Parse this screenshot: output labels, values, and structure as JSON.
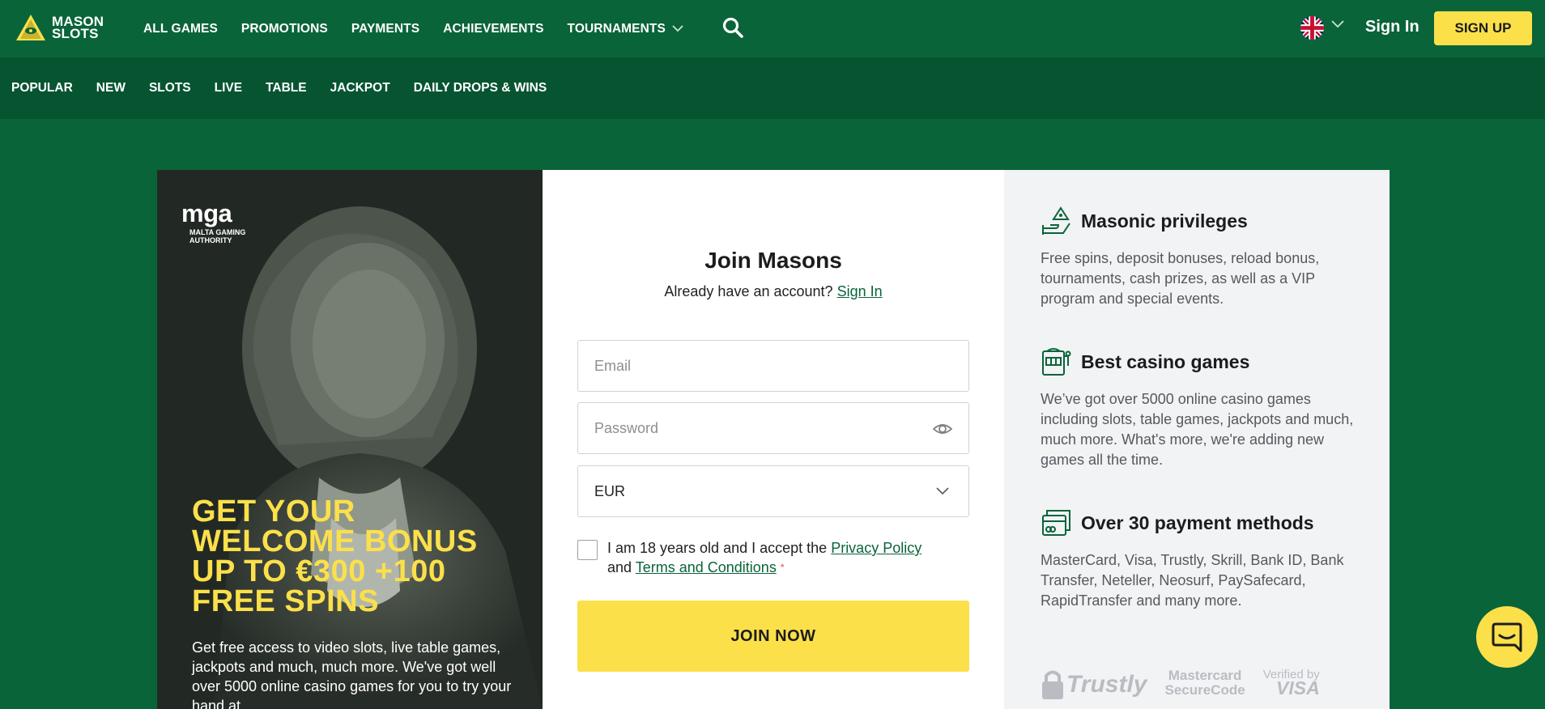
{
  "brand": {
    "line1": "MASON",
    "line2": "SLOTS"
  },
  "nav": {
    "items": [
      "ALL GAMES",
      "PROMOTIONS",
      "PAYMENTS",
      "ACHIEVEMENTS",
      "TOURNAMENTS"
    ],
    "signin": "Sign In",
    "signup": "SIGN UP"
  },
  "subnav": {
    "items": [
      "POPULAR",
      "NEW",
      "SLOTS",
      "LIVE",
      "TABLE",
      "JACKPOT",
      "DAILY DROPS & WINS"
    ]
  },
  "promo": {
    "mga_logo": "mga",
    "mga_caption_1": "MALTA GAMING",
    "mga_caption_2": "AUTHORITY",
    "headline_1": "GET YOUR",
    "headline_2": "WELCOME BONUS",
    "headline_3": "UP TO €300 +100",
    "headline_4": "FREE SPINS",
    "text": "Get free access to video slots, live table games, jackpots and much, much more. We've got well over 5000 online casino games for you to try your hand at."
  },
  "form": {
    "title": "Join Masons",
    "subtitle": "Already have an account?",
    "signin_link": "Sign In",
    "email_placeholder": "Email",
    "password_placeholder": "Password",
    "currency": "EUR",
    "consent_1": "I am 18 years old and I accept the",
    "privacy": "Privacy Policy",
    "consent_and": "and",
    "terms": "Terms and Conditions",
    "required_mark": "*",
    "submit": "JOIN NOW"
  },
  "benefits": [
    {
      "icon": "pyramid-hand-icon",
      "title": "Masonic privileges",
      "text": "Free spins, deposit bonuses, reload bonus, tournaments, cash prizes, as well as a VIP program and special events."
    },
    {
      "icon": "slot-machine-icon",
      "title": "Best casino games",
      "text": "We’ve got over 5000 online casino games including slots, table games, jackpots and much, much more. What's more, we're adding new games all the time."
    },
    {
      "icon": "credit-card-icon",
      "title": "Over 30 payment methods",
      "text": "MasterCard, Visa, Trustly, Skrill, Bank ID, Bank Transfer, Neteller, Neosurf, PaySafecard, RapidTransfer and many more."
    }
  ],
  "payment_logos": {
    "trustly": "Trustly",
    "mastercard_1": "Mastercard",
    "mastercard_2": "SecureCode",
    "visa_1": "Verified by",
    "visa_2": "VISA"
  },
  "colors": {
    "brand_green": "#0a6439",
    "accent_yellow": "#fbe04a"
  }
}
